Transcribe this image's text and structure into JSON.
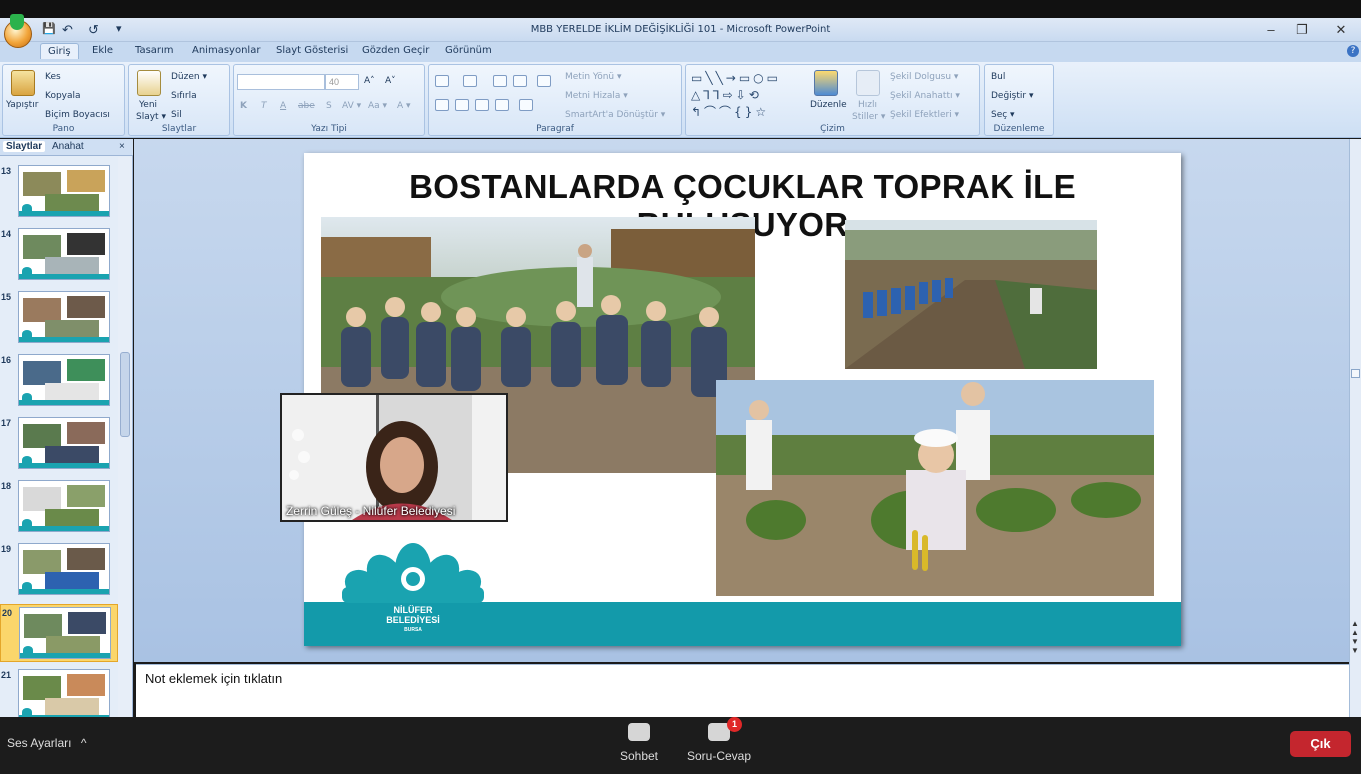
{
  "window": {
    "title": "MBB YERELDE İKLİM DEĞİŞİKLİĞİ 101 - Microsoft PowerPoint",
    "minimize": "–",
    "restore": "❐",
    "close": "✕"
  },
  "qat": {
    "save": "💾",
    "undo": "↶",
    "redo": "↺",
    "more": "▾"
  },
  "tabs": [
    "Giriş",
    "Ekle",
    "Tasarım",
    "Animasyonlar",
    "Slayt Gösterisi",
    "Gözden Geçir",
    "Görünüm"
  ],
  "help_icon": "?",
  "ribbon": {
    "pano": {
      "name": "Pano",
      "paste": "Yapıştır",
      "cut": "Kes",
      "copy": "Kopyala",
      "format_painter": "Biçim Boyacısı"
    },
    "slaytlar": {
      "name": "Slaytlar",
      "new_slide_1": "Yeni",
      "new_slide_2": "Slayt ▾",
      "layout": "Düzen ▾",
      "reset": "Sıfırla",
      "delete": "Sil"
    },
    "yazi_tipi": {
      "name": "Yazı Tipi",
      "font_size": "40",
      "grow": "A˄",
      "shrink": "A˅",
      "bold": "K",
      "italic": "T",
      "underline": "A",
      "strike": "abe",
      "shadow": "S",
      "spacing": "AV ▾",
      "case": "Aa ▾",
      "color": "A ▾"
    },
    "paragraf": {
      "name": "Paragraf",
      "text_direction": "Metin Yönü ▾",
      "align_text": "Metni Hizala ▾",
      "smartart": "SmartArt'a Dönüştür ▾"
    },
    "cizim": {
      "name": "Çizim",
      "arrange_1": "Düzenle",
      "quick_styles_1": "Hızlı",
      "quick_styles_2": "Stiller ▾",
      "fill": "Şekil Dolgusu ▾",
      "outline": "Şekil Anahattı ▾",
      "effects": "Şekil Efektleri ▾"
    },
    "duzenleme": {
      "name": "Düzenleme",
      "find": "Bul",
      "replace": "Değiştir ▾",
      "select": "Seç ▾"
    }
  },
  "side_panel": {
    "tab_slides": "Slaytlar",
    "tab_outline": "Anahat",
    "close": "×",
    "thumbnails": [
      {
        "num": "13",
        "selected": false
      },
      {
        "num": "14",
        "selected": false
      },
      {
        "num": "15",
        "selected": false
      },
      {
        "num": "16",
        "selected": false
      },
      {
        "num": "17",
        "selected": false
      },
      {
        "num": "18",
        "selected": false
      },
      {
        "num": "19",
        "selected": false
      },
      {
        "num": "20",
        "selected": true
      },
      {
        "num": "21",
        "selected": false
      }
    ]
  },
  "slide": {
    "title": "BOSTANLARDA ÇOCUKLAR TOPRAK İLE BULUŞUYOR",
    "logo_line1": "NİLÜFER",
    "logo_line2": "BELEDİYESİ",
    "logo_line3": "BURSA"
  },
  "video_tile": {
    "name": "Zerrin Güleş - Nilüfer Belediyesi"
  },
  "notes": {
    "placeholder": "Not eklemek için tıklatın"
  },
  "zoom_bar": {
    "audio": "Ses Ayarları",
    "audio_caret": "^",
    "chat": "Sohbet",
    "qa": "Soru-Cevap",
    "qa_badge": "1",
    "leave": "Çık"
  },
  "colors": {
    "accent_teal": "#139aaa",
    "leave_red": "#c4262e",
    "selected_thumb": "#fbd66b"
  }
}
